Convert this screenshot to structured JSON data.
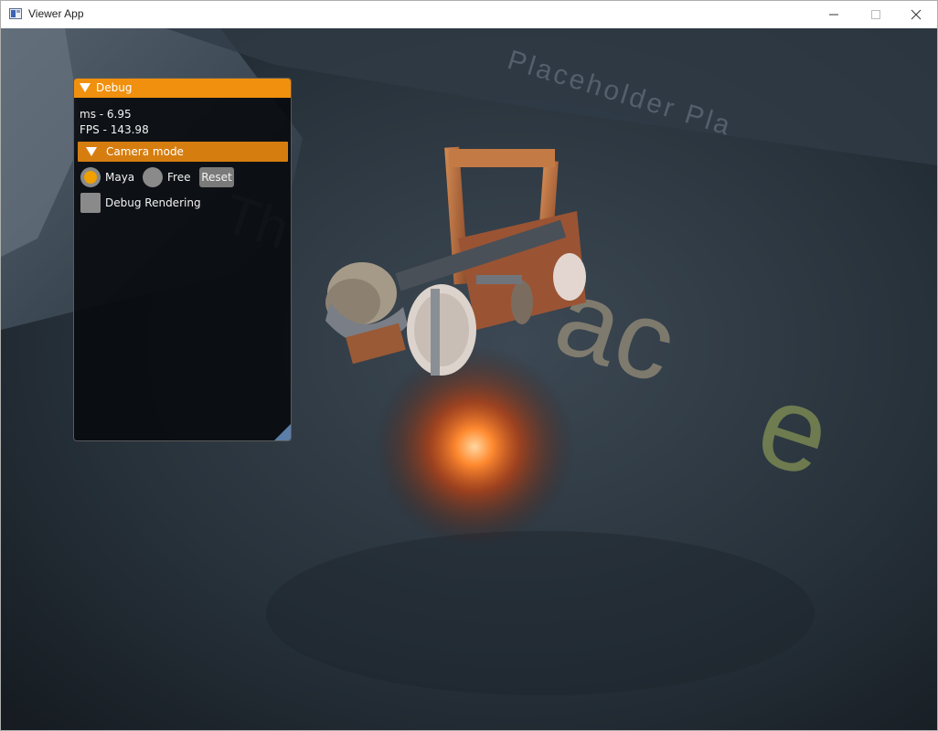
{
  "window": {
    "title": "Viewer App",
    "controls": {
      "minimize_icon": "minimize-icon",
      "maximize_icon": "maximize-icon",
      "close_icon": "close-icon"
    }
  },
  "scene": {
    "background_text_1": "Placeholder Pla",
    "bottom_text": "..... ..... ..... ..... ..... ..... ..... ..... ..... ..... ..... ..... ..... ..... ....."
  },
  "debug_panel": {
    "title": "Debug",
    "ms_label": "ms - 6.95",
    "fps_label": "FPS - 143.98",
    "camera_section": "Camera mode",
    "camera_options": {
      "maya": "Maya",
      "free": "Free"
    },
    "selected_camera": "Maya",
    "reset_label": "Reset",
    "debug_rendering_label": "Debug Rendering",
    "debug_rendering_checked": false
  },
  "colors": {
    "accent": "#f0900e",
    "section": "#d67d10",
    "panel_bg": "#06080c",
    "radio_selected": "#f0a000"
  }
}
